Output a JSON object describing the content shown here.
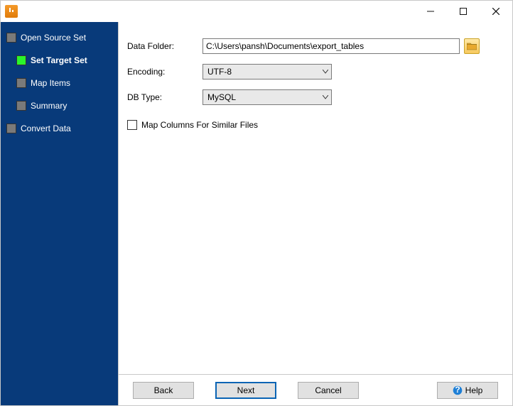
{
  "window": {
    "title": "",
    "controls": {
      "minimize": "-",
      "maximize": "▢",
      "close": "×"
    }
  },
  "sidebar": {
    "items": [
      {
        "label": "Open Source Set",
        "active": false,
        "child": false
      },
      {
        "label": "Set Target Set",
        "active": true,
        "child": true
      },
      {
        "label": "Map Items",
        "active": false,
        "child": true
      },
      {
        "label": "Summary",
        "active": false,
        "child": true
      },
      {
        "label": "Convert Data",
        "active": false,
        "child": false
      }
    ]
  },
  "form": {
    "dataFolderLabel": "Data Folder:",
    "dataFolderValue": "C:\\Users\\pansh\\Documents\\export_tables",
    "encodingLabel": "Encoding:",
    "encodingValue": "UTF-8",
    "dbTypeLabel": "DB Type:",
    "dbTypeValue": "MySQL",
    "mapColumnsLabel": "Map Columns For Similar Files"
  },
  "buttons": {
    "back": "Back",
    "next": "Next",
    "cancel": "Cancel",
    "help": "Help"
  }
}
